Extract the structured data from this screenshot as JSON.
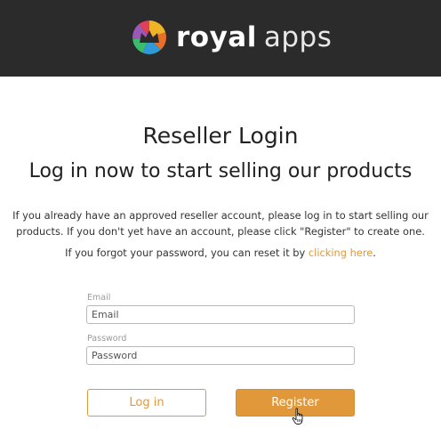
{
  "header": {
    "brand_bold": "royal",
    "brand_light": "apps",
    "logo_icon": "crown-logo-icon"
  },
  "page": {
    "title": "Reseller Login",
    "subtitle": "Log in now to start selling our products",
    "intro": "If you already have an approved reseller account, please log in to start selling our products. If you don't yet have an account, please click \"Register\" to create one.",
    "forgot_prefix": "If you forgot your password, you can reset it by ",
    "forgot_link": "clicking here",
    "forgot_suffix": "."
  },
  "form": {
    "email_label": "Email",
    "email_placeholder": "Email",
    "email_value": "",
    "password_label": "Password",
    "password_placeholder": "Password",
    "password_value": ""
  },
  "buttons": {
    "login": "Log in",
    "register": "Register"
  },
  "colors": {
    "header_bg": "#2b2b2b",
    "accent": "#e0983a"
  }
}
